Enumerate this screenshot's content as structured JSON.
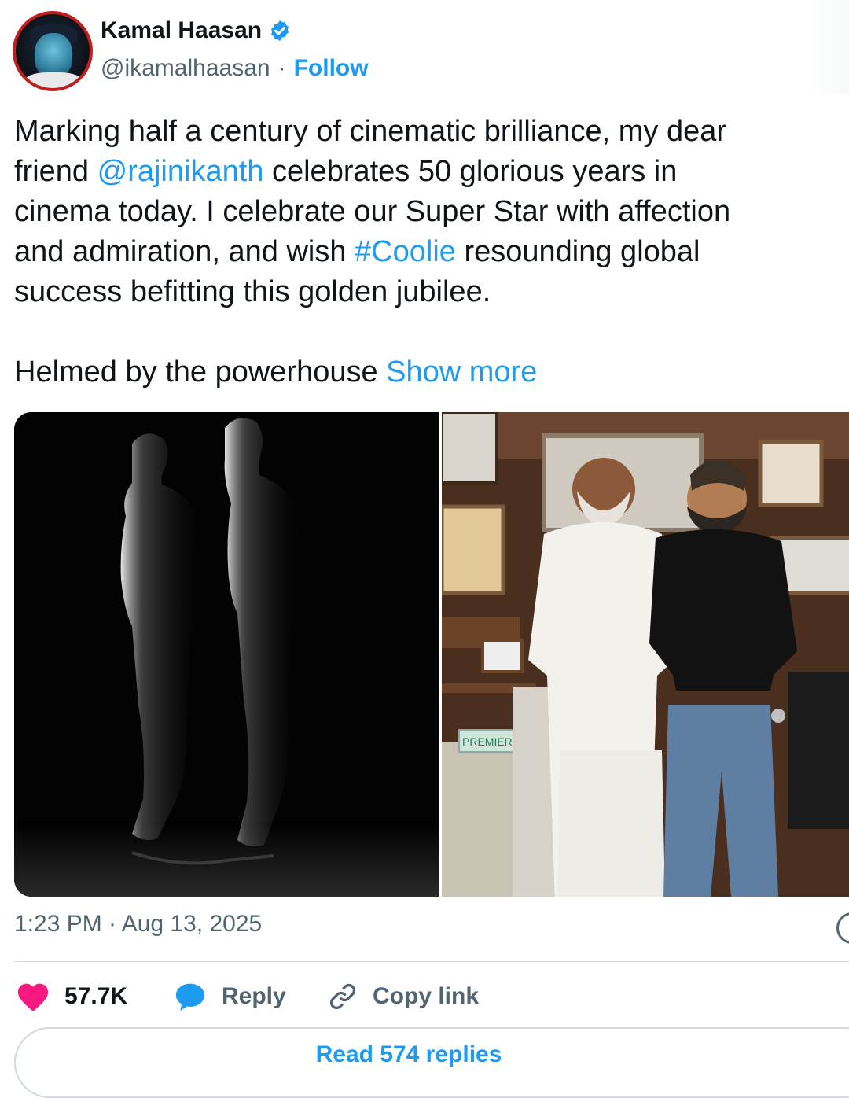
{
  "author": {
    "name": "Kamal Haasan",
    "handle": "@ikamalhaasan",
    "separator": "·",
    "follow_label": "Follow"
  },
  "tweet": {
    "line1": "Marking half a century of cinematic brilliance, my dear",
    "line2_pre": "friend ",
    "mention": "@rajinikanth",
    "line2_post": " celebrates 50 glorious years in",
    "line3": "cinema today. I celebrate our Super Star with affection",
    "line4_pre": "and admiration, and wish ",
    "hashtag": "#Coolie",
    "line4_post": " resounding global",
    "line5": "success befitting this golden jubilee.",
    "line6_pre": "Helmed by the powerhouse ",
    "show_more": "Show more"
  },
  "media": {
    "photo_left_sign": "",
    "photo_right_sign": "PREMIER"
  },
  "meta": {
    "timestamp": "1:23 PM · Aug 13, 2025"
  },
  "actions": {
    "likes": "57.7K",
    "reply_label": "Reply",
    "copy_link_label": "Copy link"
  },
  "footer": {
    "read_replies": "Read 574 replies"
  },
  "colors": {
    "accent": "#1d9bf0",
    "like": "#f91880",
    "text": "#0f1419",
    "muted": "#536471"
  }
}
